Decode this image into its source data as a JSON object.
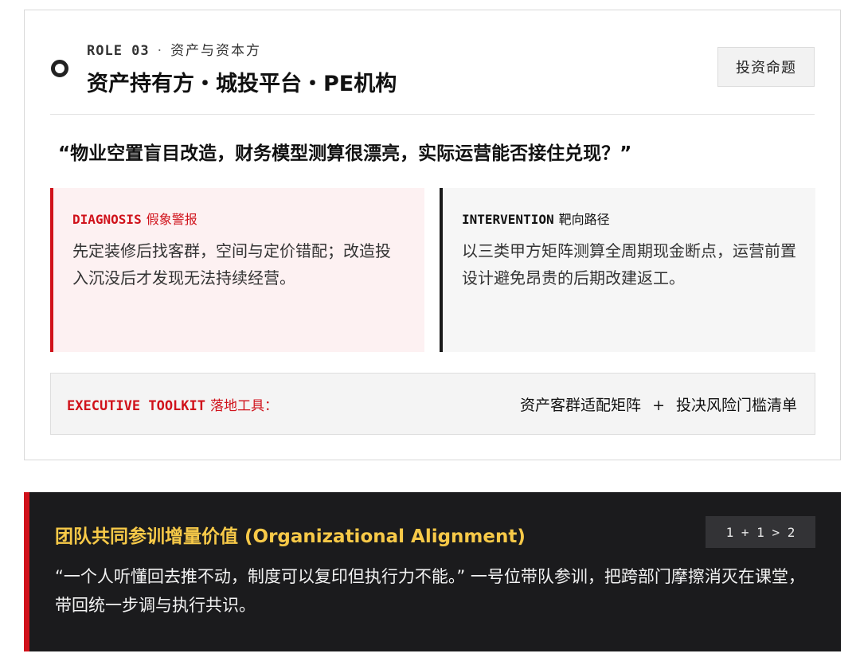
{
  "role_card": {
    "eyebrow_code": "ROLE 03",
    "eyebrow_sep": "·",
    "eyebrow_sub": "资产与资本方",
    "title": "资产持有方・城投平台・PE机构",
    "tag": "投资命题",
    "quote": "“物业空置盲目改造，财务模型测算很漂亮，实际运营能否接住兑现？”",
    "diagnosis": {
      "code": "DIAGNOSIS",
      "label": "假象警报",
      "text": "先定装修后找客群，空间与定价错配；改造投入沉没后才发现无法持续经营。"
    },
    "intervention": {
      "code": "INTERVENTION",
      "label": "靶向路径",
      "text": "以三类甲方矩阵测算全周期现金断点，运营前置设计避免昂贵的后期改建返工。"
    },
    "toolkit": {
      "code": "EXECUTIVE TOOLKIT",
      "label": "落地工具：",
      "item_1": "资产客群适配矩阵",
      "plus": "+",
      "item_2": "投决风险门槛清单"
    }
  },
  "team_band": {
    "title": "团队共同参训增量价值 (Organizational Alignment)",
    "badge": "1 + 1 > 2",
    "text": "“一个人听懂回去推不动，制度可以复印但执行力不能。” 一号位带队参训，把跨部门摩擦消灭在课堂，带回统一步调与执行共识。"
  },
  "colors": {
    "accent_red": "#d0121b",
    "band_bg": "#1b1b1d",
    "band_title": "#f7c948"
  },
  "icons": {
    "role_marker": "ring-icon"
  }
}
